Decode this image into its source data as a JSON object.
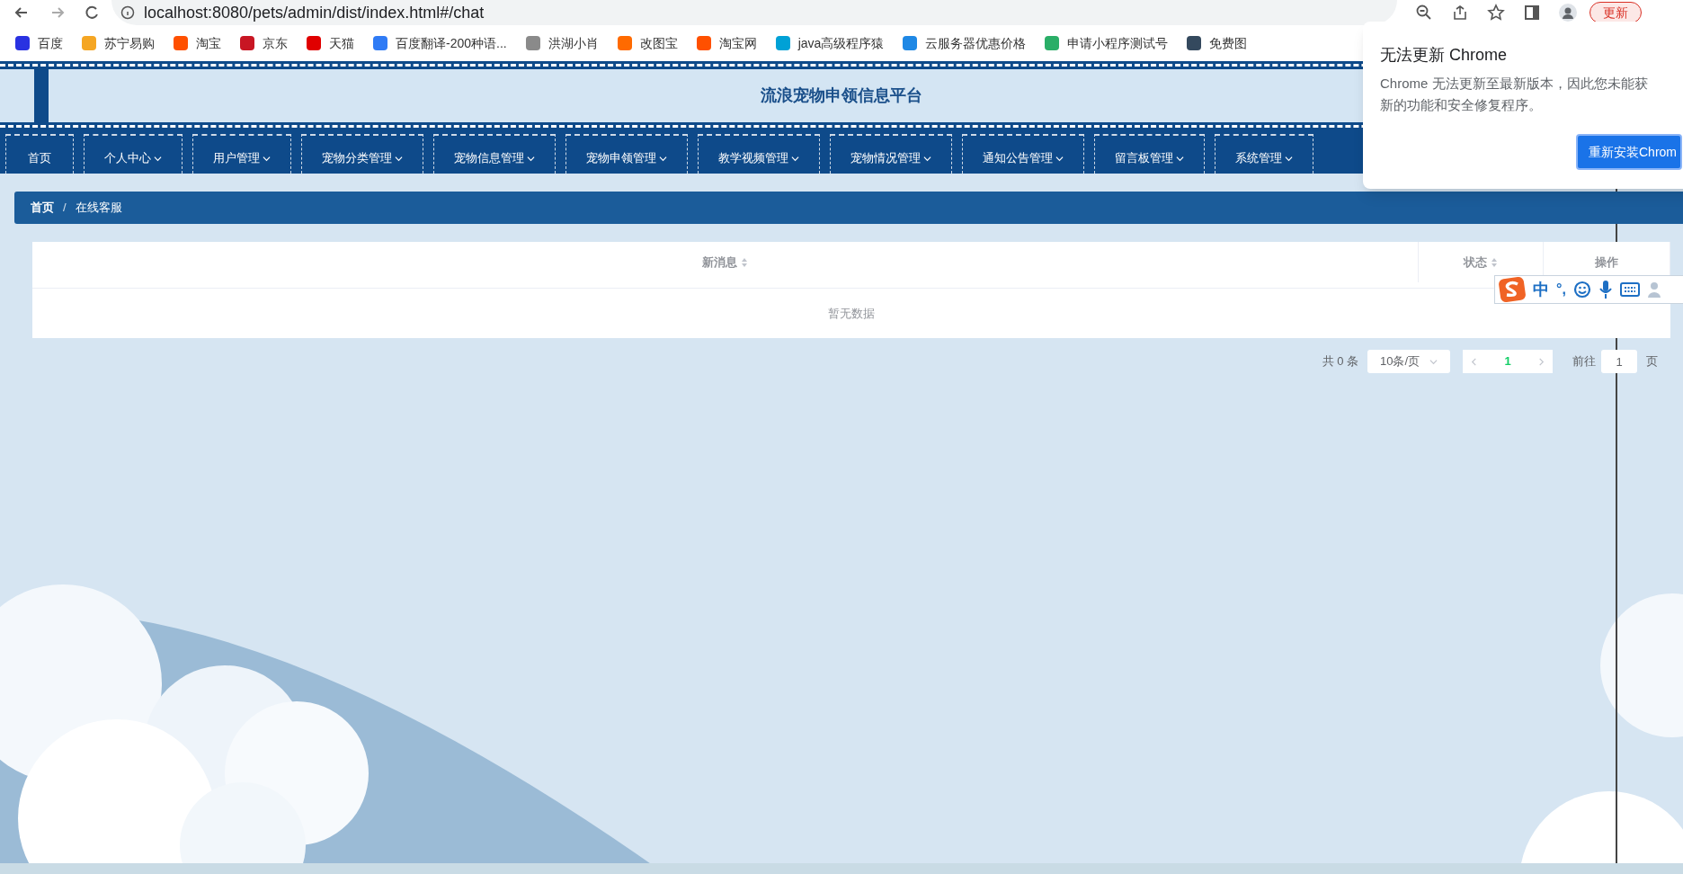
{
  "browser": {
    "url": "localhost:8080/pets/admin/dist/index.html#/chat",
    "update_button": "更新",
    "bookmarks": [
      "百度",
      "苏宁易购",
      "淘宝",
      "京东",
      "天猫",
      "百度翻译-200种语...",
      "洪湖小肖",
      "改图宝",
      "淘宝网",
      "java高级程序猿",
      "云服务器优惠价格",
      "申请小程序测试号",
      "免费图"
    ]
  },
  "header": {
    "title": "流浪宠物申领信息平台"
  },
  "nav": [
    {
      "label": "首页",
      "dropdown": false
    },
    {
      "label": "个人中心",
      "dropdown": true
    },
    {
      "label": "用户管理",
      "dropdown": true
    },
    {
      "label": "宠物分类管理",
      "dropdown": true
    },
    {
      "label": "宠物信息管理",
      "dropdown": true
    },
    {
      "label": "宠物申领管理",
      "dropdown": true
    },
    {
      "label": "教学视频管理",
      "dropdown": true
    },
    {
      "label": "宠物情况管理",
      "dropdown": true
    },
    {
      "label": "通知公告管理",
      "dropdown": true
    },
    {
      "label": "留言板管理",
      "dropdown": true
    },
    {
      "label": "系统管理",
      "dropdown": true
    }
  ],
  "breadcrumb": {
    "items": [
      "首页",
      "在线客服"
    ],
    "separator": "/"
  },
  "table": {
    "columns": [
      {
        "label": "新消息",
        "sortable": true
      },
      {
        "label": "状态",
        "sortable": true
      },
      {
        "label": "操作",
        "sortable": false
      }
    ],
    "empty_text": "暂无数据"
  },
  "pagination": {
    "total": "共 0 条",
    "page_size": "10条/页",
    "pages": [
      {
        "label": "1",
        "selected": true
      }
    ],
    "goto_label": "前往",
    "goto_value": "1",
    "goto_suffix": "页"
  },
  "popup": {
    "title": "无法更新 Chrome",
    "body": [
      "Chrome 无法更新至最新版本，因此您未能获",
      "新的功能和安全修复程序。"
    ],
    "button": "重新安装Chrom"
  },
  "ime": {
    "mode": "中",
    "punct": "°,"
  }
}
